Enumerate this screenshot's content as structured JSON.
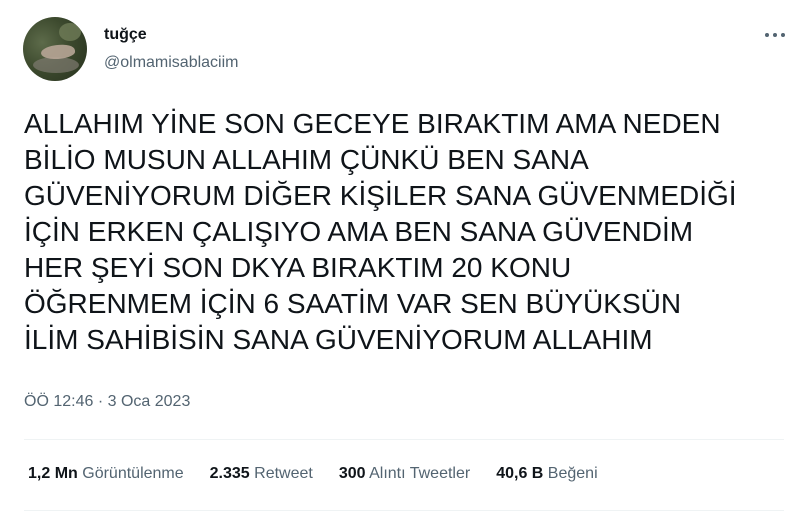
{
  "author": {
    "display_name": "tuğçe",
    "username": "@olmamisablaciim"
  },
  "tweet": {
    "text": "ALLAHIM YİNE SON GECEYE BIRAKTIM AMA NEDEN\nBİLİO MUSUN ALLAHIM ÇÜNKÜ BEN SANA\nGÜVENİYORUM DİĞER KİŞİLER SANA GÜVENMEDİĞİ\nİÇİN ERKEN ÇALIŞIYO AMA BEN SANA GÜVENDİM\nHER ŞEYİ SON DKYA BIRAKTIM 20 KONU\nÖĞRENMEM İÇİN 6 SAATİM VAR SEN BÜYÜKSÜN\nİLİM SAHİBİSİN SANA GÜVENİYORUM ALLAHIM",
    "time": "ÖÖ 12:46",
    "separator": "·",
    "date": "3 Oca 2023"
  },
  "stats": {
    "views": {
      "count": "1,2 Mn",
      "label": "Görüntülenme"
    },
    "retweets": {
      "count": "2.335",
      "label": "Retweet"
    },
    "quotes": {
      "count": "300",
      "label": "Alıntı Tweetler"
    },
    "likes": {
      "count": "40,6 B",
      "label": "Beğeni"
    }
  },
  "icons": {
    "more": "more-horizontal-icon"
  },
  "colors": {
    "text_primary": "#0f1419",
    "text_secondary": "#536471",
    "divider": "#eff3f4"
  }
}
